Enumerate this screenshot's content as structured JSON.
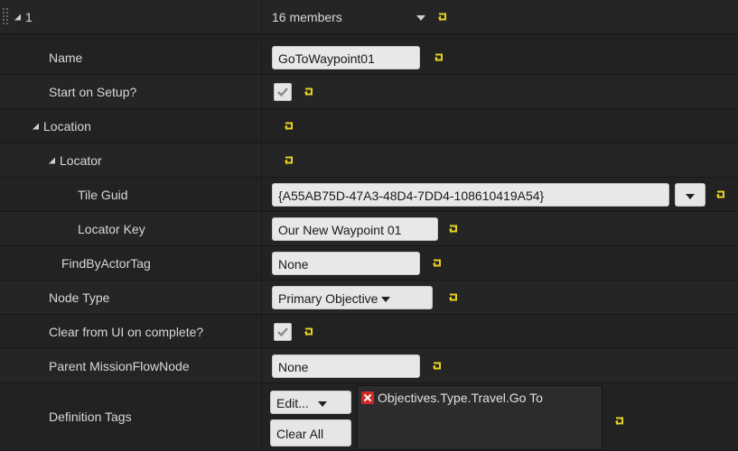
{
  "colors": {
    "reset_arrow": "#e8d21f",
    "panel_bg": "#252525",
    "field_bg": "#e8e8e8",
    "tag_remove": "#cc2a2a"
  },
  "header": {
    "index": "1",
    "members": "16 members"
  },
  "rows": {
    "name": {
      "label": "Name",
      "value": "GoToWaypoint01"
    },
    "start_on_setup": {
      "label": "Start on Setup?",
      "checked": true
    },
    "location": {
      "label": "Location"
    },
    "locator": {
      "label": "Locator"
    },
    "tile_guid": {
      "label": "Tile Guid",
      "value": "{A55AB75D-47A3-48D4-7DD4-108610419A54}"
    },
    "locator_key": {
      "label": "Locator Key",
      "value": "Our New Waypoint 01"
    },
    "find_by_actor_tag": {
      "label": "FindByActorTag",
      "value": "None"
    },
    "node_type": {
      "label": "Node Type",
      "value": "Primary Objective"
    },
    "clear_from_ui": {
      "label": "Clear from UI on complete?",
      "checked": true
    },
    "parent_mission_flow_node": {
      "label": "Parent MissionFlowNode",
      "value": "None"
    },
    "definition_tags": {
      "label": "Definition Tags",
      "edit_label": "Edit...",
      "clear_all_label": "Clear All",
      "tags": [
        "Objectives.Type.Travel.Go To"
      ]
    }
  },
  "icons": {
    "expand": "triangle-expanded-icon",
    "reset": "reset-to-default-icon",
    "check": "checkmark-icon",
    "dropdown": "chevron-down-icon",
    "remove": "remove-tag-icon"
  }
}
